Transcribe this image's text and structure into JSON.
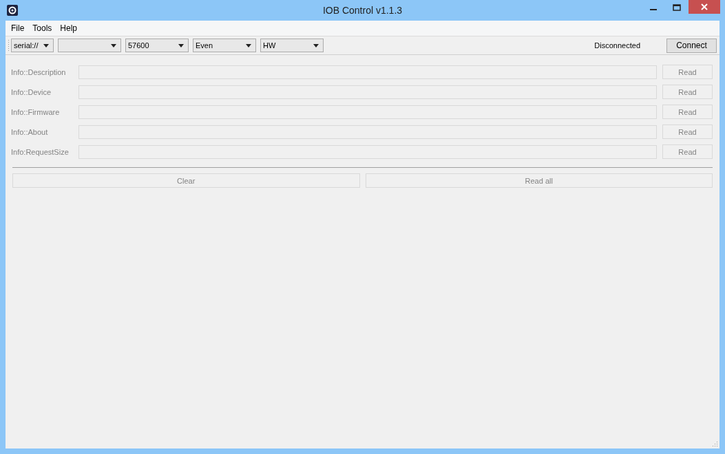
{
  "window": {
    "title": "IOB Control v1.1.3"
  },
  "menu": [
    "File",
    "Tools",
    "Help"
  ],
  "toolbar": {
    "combos": [
      {
        "value": "serial://",
        "disabled": false
      },
      {
        "disabled": false
      },
      {
        "value": "57600",
        "disabled": false
      },
      {
        "value": "Even",
        "disabled": false
      },
      {
        "value": "HW",
        "disabled": false
      }
    ],
    "status": "Disconnected",
    "connect_button": "Connect"
  },
  "fields": [
    {
      "label": "Info::Description",
      "button": "Read",
      "disabled": true
    },
    {
      "label": "Info::Device",
      "button": "Read",
      "disabled": true
    },
    {
      "label": "Info::Firmware",
      "button": "Read",
      "disabled": true
    },
    {
      "label": "Info::About",
      "button": "Read",
      "disabled": true
    },
    {
      "label": "Info:RequestSize",
      "button": "Read",
      "disabled": true
    }
  ],
  "actions": [
    {
      "label": "Clear",
      "disabled": true
    },
    {
      "label": "Read all",
      "disabled": true
    }
  ]
}
